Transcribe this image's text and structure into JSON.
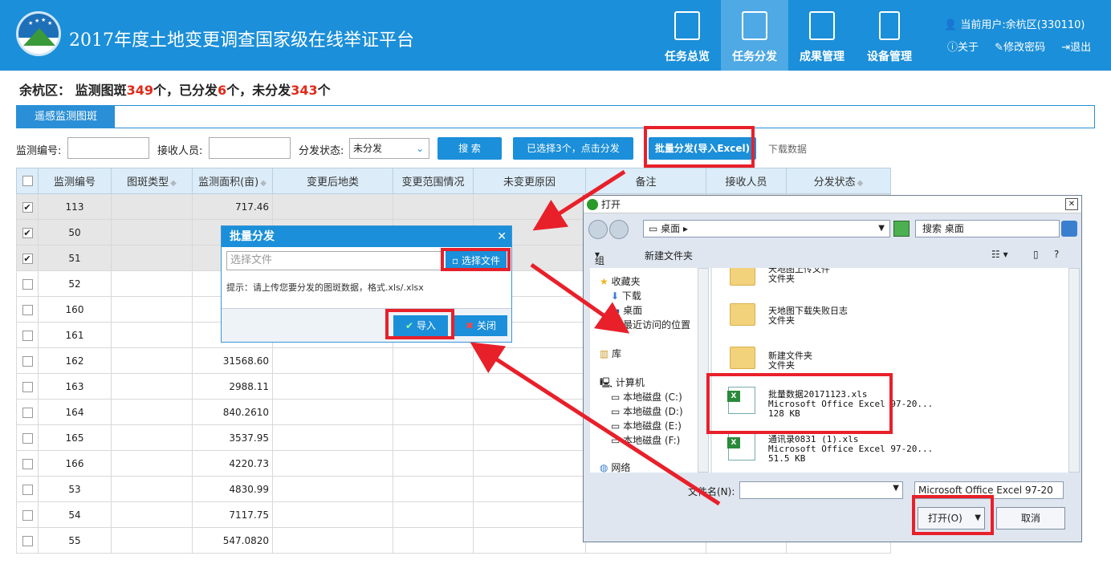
{
  "header": {
    "app_title": "2017年度土地变更调查国家级在线举证平台",
    "nav": [
      {
        "label": "任务总览",
        "icon": "task-overview-icon"
      },
      {
        "label": "任务分发",
        "icon": "task-dispatch-icon"
      },
      {
        "label": "成果管理",
        "icon": "results-management-icon"
      },
      {
        "label": "设备管理",
        "icon": "device-management-icon"
      }
    ],
    "current_user": "当前用户:余杭区(330110)",
    "links": {
      "about": "关于",
      "change_password": "修改密码",
      "logout": "退出"
    }
  },
  "summary": {
    "region": "余杭区：",
    "monitor_prefix": "监测图斑",
    "monitor_count": "349",
    "unit1": "个，已分发",
    "dispatched_count": "6",
    "unit2": "个，未分发",
    "undispatched_count": "343",
    "unit3": "个"
  },
  "tabs": {
    "active": "遥感监测图斑"
  },
  "filters": {
    "monitor_id_label": "监测编号:",
    "receiver_label": "接收人员:",
    "status_label": "分发状态:",
    "status_value": "未分发",
    "search_button": "搜 索",
    "dispatch_selected_button": "已选择3个，点击分发",
    "batch_button": "批量分发(导入Excel)",
    "download_link": "下载数据"
  },
  "table": {
    "headers": [
      "监测编号",
      "图斑类型",
      "监测面积(亩)",
      "变更后地类",
      "变更范围情况",
      "未变更原因",
      "备注",
      "接收人员",
      "分发状态"
    ],
    "rows": [
      {
        "id": "113",
        "area": "717.46",
        "checked": true
      },
      {
        "id": "50",
        "area": "",
        "checked": true
      },
      {
        "id": "51",
        "area": "",
        "checked": true
      },
      {
        "id": "52",
        "area": "",
        "checked": false
      },
      {
        "id": "160",
        "area": "",
        "checked": false
      },
      {
        "id": "161",
        "area": "",
        "checked": false
      },
      {
        "id": "162",
        "area": "31568.60",
        "checked": false
      },
      {
        "id": "163",
        "area": "2988.11",
        "checked": false
      },
      {
        "id": "164",
        "area": "840.2610",
        "checked": false
      },
      {
        "id": "165",
        "area": "3537.95",
        "checked": false
      },
      {
        "id": "166",
        "area": "4220.73",
        "checked": false
      },
      {
        "id": "53",
        "area": "4830.99",
        "checked": false
      },
      {
        "id": "54",
        "area": "7117.75",
        "checked": false
      },
      {
        "id": "55",
        "area": "547.0820",
        "checked": false
      }
    ]
  },
  "popup": {
    "title": "批量分发",
    "file_placeholder": "选择文件",
    "pick_button": "选择文件",
    "hint": "提示：请上传您要分发的图斑数据，格式.xls/.xlsx",
    "import_button": "导入",
    "close_button": "关闭"
  },
  "file_dialog": {
    "title": "打开",
    "location": "桌面",
    "search_placeholder": "搜索 桌面",
    "organize": "组织",
    "new_folder": "新建文件夹",
    "nav_items": [
      "收藏夹",
      "下载",
      "桌面",
      "最近访问的位置",
      "库",
      "计算机",
      "本地磁盘 (C:)",
      "本地磁盘 (D:)",
      "本地磁盘 (E:)",
      "本地磁盘 (F:)",
      "网络"
    ],
    "files": [
      {
        "name": "天地图上传文件",
        "type": "文件夹"
      },
      {
        "name": "天地图下载失败日志",
        "type": "文件夹"
      },
      {
        "name": "新建文件夹",
        "type": "文件夹"
      },
      {
        "name": "批量数据20171123.xls",
        "type": "Microsoft Office Excel 97-20...",
        "size": "128 KB"
      },
      {
        "name": "通讯录0831 (1).xls",
        "type": "Microsoft Office Excel 97-20...",
        "size": "51.5 KB"
      }
    ],
    "filename_label": "文件名(N):",
    "filetype_value": "Microsoft Office Excel 97-20",
    "open_button": "打开(O)",
    "cancel_button": "取消"
  },
  "colors": {
    "header_blue": "#1b8fd9",
    "highlight_red": "#e8202a",
    "count_red": "#e02a1a"
  }
}
